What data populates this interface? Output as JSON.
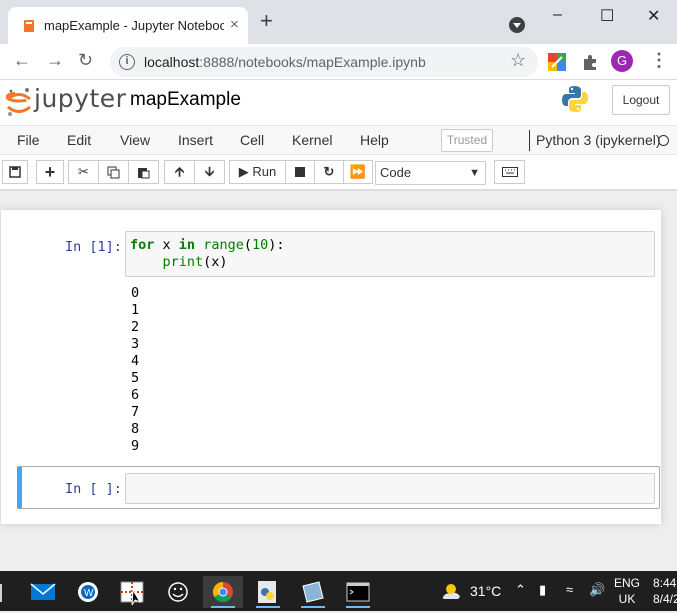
{
  "browser": {
    "tab_title": "mapExample - Jupyter Notebook",
    "tab_close": "×",
    "new_tab": "+",
    "url_host": "localhost",
    "url_path": ":8888/notebooks/mapExample.ipynb",
    "avatar_letter": "G",
    "window_controls": [
      "–",
      "☐",
      "✕"
    ]
  },
  "jupyter": {
    "brand": "jupyter",
    "notebook_name": "mapExample",
    "logout_label": "Logout",
    "menu": [
      "File",
      "Edit",
      "View",
      "Insert",
      "Cell",
      "Kernel",
      "Help"
    ],
    "trusted_label": "Trusted",
    "kernel_name": "Python 3 (ipykernel)",
    "toolbar": {
      "run_label": "Run",
      "cell_type": "Code"
    }
  },
  "cells": [
    {
      "prompt": "In [1]:",
      "code_lines": [
        {
          "kw1": "for",
          "text1": " x ",
          "kw2": "in",
          "text2": " ",
          "builtin": "range",
          "text3": "(",
          "num": "10",
          "text4": "):"
        },
        {
          "indent": "    ",
          "builtin": "print",
          "rest": "(x)"
        }
      ],
      "output": [
        "0",
        "1",
        "2",
        "3",
        "4",
        "5",
        "6",
        "7",
        "8",
        "9"
      ]
    },
    {
      "prompt": "In [ ]:",
      "code": ""
    }
  ],
  "taskbar": {
    "weather": "31°C",
    "lang_top": "ENG",
    "lang_bottom": "UK",
    "time": "8:44",
    "date": "8/4/2"
  },
  "colors": {
    "selected_cell_border": "#42a5f5",
    "prompt_color": "#303f9f",
    "keyword_color": "#008000"
  }
}
